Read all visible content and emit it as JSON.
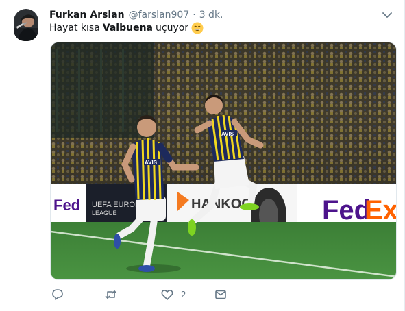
{
  "user": {
    "name": "Furkan Arslan",
    "handle": "@farslan907",
    "separator": "·",
    "time": "3 dk."
  },
  "tweet": {
    "text_before": "Hayat kısa",
    "text_bold": "Valbuena",
    "text_after": "uçuyor",
    "emoji": "grinning-face-emoji"
  },
  "media": {
    "banner_brands": [
      "FedEx",
      "UEFA EUROPA LEAGUE",
      "HANKOOK",
      "FedEx"
    ],
    "jersey_brand": "AVIS"
  },
  "actions": {
    "reply_count": "",
    "retweet_count": "",
    "like_count": "2"
  },
  "colors": {
    "text_primary": "#14171a",
    "text_secondary": "#657786",
    "pitch_green": "#3f8a3a",
    "fedex_purple": "#4d148c",
    "fedex_orange": "#ff6200",
    "hankook_orange": "#f47a20"
  }
}
